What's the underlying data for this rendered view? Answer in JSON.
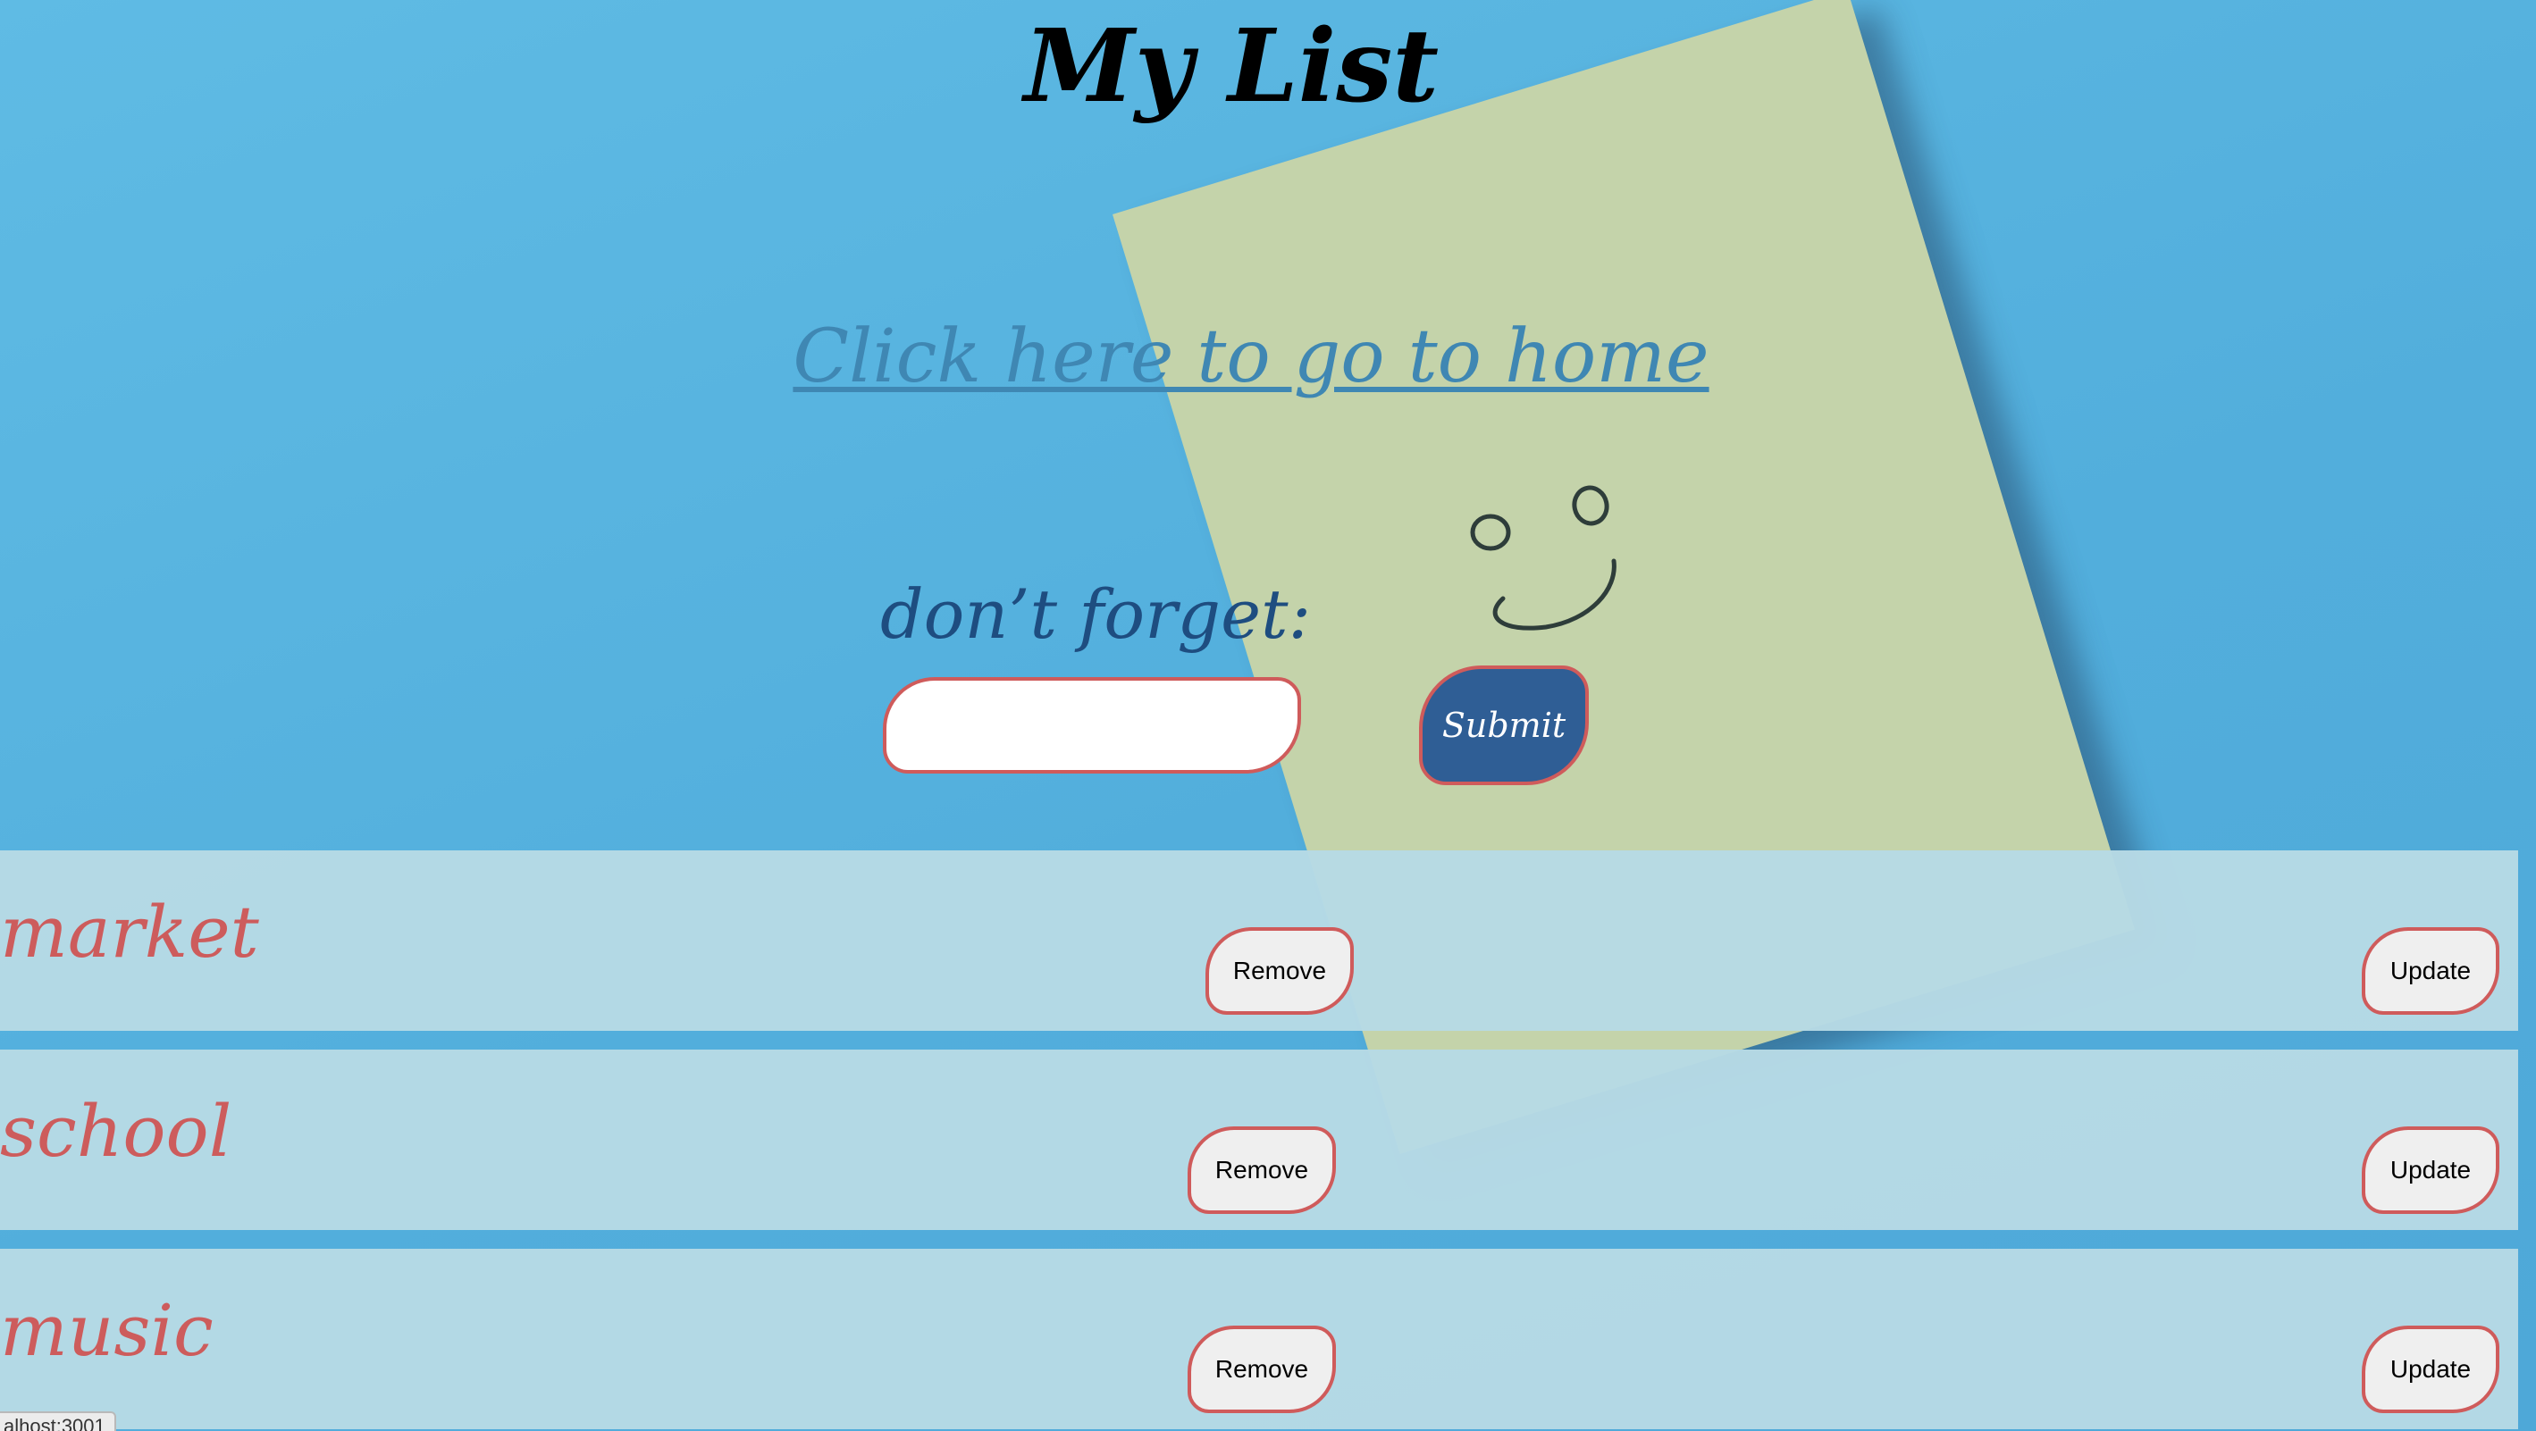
{
  "title": "My List",
  "home_link": "Click here to go to home",
  "form": {
    "label": "don’t forget:",
    "input_value": "",
    "submit_label": "Submit"
  },
  "items": [
    {
      "text": "market",
      "remove_label": "Remove",
      "update_label": "Update"
    },
    {
      "text": "school",
      "remove_label": "Remove",
      "update_label": "Update"
    },
    {
      "text": "music",
      "remove_label": "Remove",
      "update_label": "Update"
    }
  ],
  "status_bar": {
    "url": "alhost:3001"
  },
  "colors": {
    "background": "#55b1de",
    "sticky_note": "#c4d3aa",
    "item_background": "#b7dae5",
    "item_text": "#cd5c5c",
    "button_border": "#cf5b5b",
    "submit_background": "#2f5e95",
    "label_text": "#1e4d80",
    "link_text": "#3f87b3"
  }
}
